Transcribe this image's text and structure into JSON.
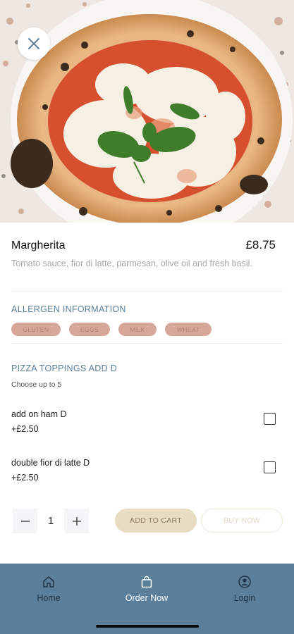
{
  "hero": {
    "image_alt": "Margherita pizza photo"
  },
  "product": {
    "name": "Margherita",
    "price": "£8.75",
    "description": "Tomato sauce, fior di latte, parmesan, olive oil and fresh basil."
  },
  "allergens": {
    "title": "ALLERGEN INFORMATION",
    "items": [
      "GLUTEN",
      "EGGS",
      "MILK",
      "WHEAT"
    ]
  },
  "toppings": {
    "title": "PIZZA TOPPINGS ADD D",
    "subtitle": "Choose up to 5",
    "options": [
      {
        "name": "add on ham D",
        "price": "+£2.50",
        "checked": false
      },
      {
        "name": "double fior di latte D",
        "price": "+£2.50",
        "checked": false
      }
    ]
  },
  "cart": {
    "quantity": "1",
    "add_to_cart_label": "ADD TO CART",
    "buy_now_label": "BUY NOW"
  },
  "tabbar": {
    "items": [
      {
        "label": "Home",
        "icon": "home-icon"
      },
      {
        "label": "Order Now",
        "icon": "bag-icon"
      },
      {
        "label": "Login",
        "icon": "user-icon"
      }
    ],
    "active": "Order Now"
  },
  "colors": {
    "accent_blue": "#5b7f9a",
    "chip_bg": "#d7a89a",
    "add_to_cart_bg": "#e8dcc3"
  }
}
